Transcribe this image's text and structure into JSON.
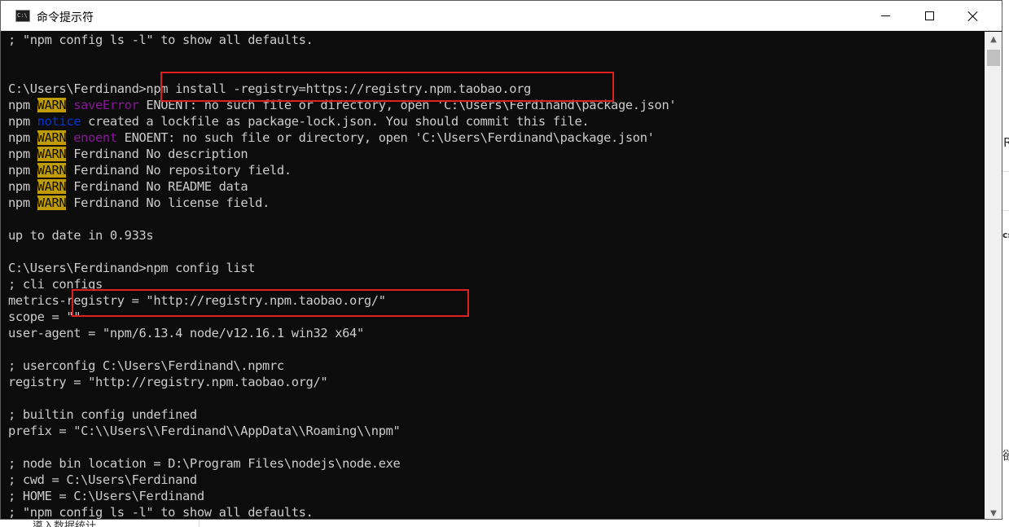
{
  "window": {
    "title": "命令提示符",
    "icon": "cmd-icon",
    "icon_text": "C:\\"
  },
  "controls": {
    "minimize": "minimize-icon",
    "maximize": "maximize-icon",
    "close": "close-icon"
  },
  "console": {
    "lines": [
      [
        {
          "t": "; \"npm config ls -l\" to show all defaults."
        }
      ],
      [
        {
          "t": ""
        }
      ],
      [
        {
          "t": ""
        }
      ],
      [
        {
          "t": "C:\\Users\\Ferdinand>npm install -registry=https://registry.npm.taobao.org"
        }
      ],
      [
        {
          "t": "npm "
        },
        {
          "t": "WARN",
          "c": "warn"
        },
        {
          "t": " "
        },
        {
          "t": "saveError",
          "c": "err"
        },
        {
          "t": " ENOENT: no such file or directory, open 'C:\\Users\\Ferdinand\\package.json'"
        }
      ],
      [
        {
          "t": "npm "
        },
        {
          "t": "notice",
          "c": "notice"
        },
        {
          "t": " created a lockfile as package-lock.json. You should commit this file."
        }
      ],
      [
        {
          "t": "npm "
        },
        {
          "t": "WARN",
          "c": "warn"
        },
        {
          "t": " "
        },
        {
          "t": "enoent",
          "c": "err"
        },
        {
          "t": " ENOENT: no such file or directory, open 'C:\\Users\\Ferdinand\\package.json'"
        }
      ],
      [
        {
          "t": "npm "
        },
        {
          "t": "WARN",
          "c": "warn"
        },
        {
          "t": " Ferdinand No description"
        }
      ],
      [
        {
          "t": "npm "
        },
        {
          "t": "WARN",
          "c": "warn"
        },
        {
          "t": " Ferdinand No repository field."
        }
      ],
      [
        {
          "t": "npm "
        },
        {
          "t": "WARN",
          "c": "warn"
        },
        {
          "t": " Ferdinand No README data"
        }
      ],
      [
        {
          "t": "npm "
        },
        {
          "t": "WARN",
          "c": "warn"
        },
        {
          "t": " Ferdinand No license field."
        }
      ],
      [
        {
          "t": ""
        }
      ],
      [
        {
          "t": "up to date in 0.933s"
        }
      ],
      [
        {
          "t": ""
        }
      ],
      [
        {
          "t": "C:\\Users\\Ferdinand>npm config list"
        }
      ],
      [
        {
          "t": "; cli configs"
        }
      ],
      [
        {
          "t": "metrics-registry = \"http://registry.npm.taobao.org/\""
        }
      ],
      [
        {
          "t": "scope = \"\""
        }
      ],
      [
        {
          "t": "user-agent = \"npm/6.13.4 node/v12.16.1 win32 x64\""
        }
      ],
      [
        {
          "t": ""
        }
      ],
      [
        {
          "t": "; userconfig C:\\Users\\Ferdinand\\.npmrc"
        }
      ],
      [
        {
          "t": "registry = \"http://registry.npm.taobao.org/\""
        }
      ],
      [
        {
          "t": ""
        }
      ],
      [
        {
          "t": "; builtin config undefined"
        }
      ],
      [
        {
          "t": "prefix = \"C:\\\\Users\\\\Ferdinand\\\\AppData\\\\Roaming\\\\npm\""
        }
      ],
      [
        {
          "t": ""
        }
      ],
      [
        {
          "t": "; node bin location = D:\\Program Files\\nodejs\\node.exe"
        }
      ],
      [
        {
          "t": "; cwd = C:\\Users\\Ferdinand"
        }
      ],
      [
        {
          "t": "; HOME = C:\\Users\\Ferdinand"
        }
      ],
      [
        {
          "t": "; \"npm config ls -l\" to show all defaults."
        }
      ]
    ]
  },
  "colors": {
    "console_bg": "#0c0c0c",
    "console_fg": "#cccccc",
    "warn_bg": "#c19c00",
    "error_fg": "#881798",
    "notice_fg": "#0037da",
    "highlight_box": "#e02020"
  },
  "scrollbar": {
    "up": "scroll-up-arrow-icon",
    "down": "scroll-down-arrow-icon",
    "up_glyph": "▲",
    "down_glyph": "▼"
  },
  "background": {
    "bottom_text": "導入数据统计",
    "right_text_1": "R",
    "right_text_2": "cs",
    "right_text_3": "欲"
  }
}
